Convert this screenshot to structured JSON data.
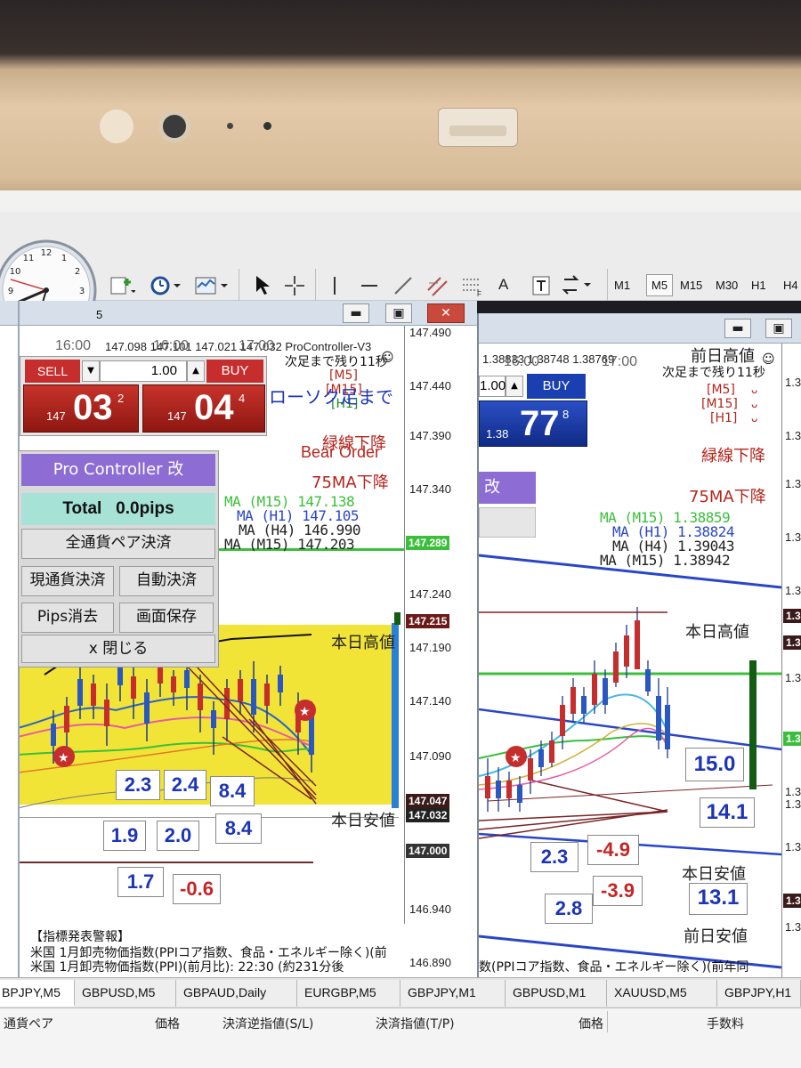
{
  "toolbar": {
    "timeframes": [
      "M1",
      "M5",
      "M15",
      "M30",
      "H1",
      "H4"
    ],
    "active_timeframe": "M5",
    "text_tool": "A"
  },
  "left_chart": {
    "window_title": "5",
    "info_line": "147.098 147.101 147.021 147.032 ProController-V3",
    "time_labels": [
      "16:00",
      "16:00",
      "17:00"
    ],
    "countdown": "次足まで残り11秒",
    "tf_markers": [
      "[M5]",
      "[M15]",
      "[H1]"
    ],
    "candle_label": "ローソク足まで",
    "trend_text": "緑線下降",
    "bear_order": "Bear Order",
    "ma75_text": "75MA下降",
    "ma_lines": [
      {
        "label": "MA (M15) 147.138",
        "color": "#3bbf3b"
      },
      {
        "label": "MA (H1) 147.105",
        "color": "#2a46c8"
      },
      {
        "label": "MA (H4) 146.990",
        "color": "#222222"
      },
      {
        "label": "MA (M15) 147.203",
        "color": "#222222"
      }
    ],
    "yaxis": [
      "147.490",
      "147.440",
      "147.390",
      "147.340",
      "147.289",
      "147.240",
      "147.215",
      "147.190",
      "147.140",
      "147.090",
      "147.047",
      "147.032",
      "147.000",
      "146.940",
      "146.890"
    ],
    "today_high": "本日高値",
    "today_low": "本日安値",
    "alert_header": "【指標発表警報】",
    "alert_line1": "米国 1月卸売物価指数(PPIコア指数、食品・エネルギー除く)(前",
    "alert_line2": "米国 1月卸売物価指数(PPI)(前月比): 22:30 (約231分後",
    "boxes": [
      "2.3",
      "2.4",
      "8.4",
      "1.9",
      "2.0",
      "8.4",
      "1.7",
      "-0.6"
    ]
  },
  "trade_panel": {
    "sell_label": "SELL",
    "buy_label": "BUY",
    "lot": "1.00",
    "sell_big": "147",
    "sell_price": "03",
    "sell_sup": "2",
    "buy_big": "147",
    "buy_price": "04",
    "buy_sup": "4"
  },
  "pro_panel": {
    "title": "Pro Controller 改",
    "total": "Total   0.0pips",
    "close_all": "全通貨ペア決済",
    "close_current": "現通貨決済",
    "auto_close": "自動決済",
    "pips_clear": "Pips消去",
    "save_screen": "画面保存",
    "close": "x 閉じる"
  },
  "right_chart": {
    "info_line": "1.38833 1.38748 1.38769",
    "time_labels": [
      "16:00",
      "17:00"
    ],
    "prev_high": "前日高値",
    "countdown": "次足まで残り11秒",
    "tf_markers": [
      "[M5]",
      "[M15]",
      "[H1]"
    ],
    "lot": "1.00",
    "buy_label": "BUY",
    "buy_big": "1.38",
    "buy_price": "77",
    "buy_sup": "8",
    "panel_stub": "改",
    "trend_text": "緑線下降",
    "ma75_text": "75MA下降",
    "ma_lines": [
      {
        "label": "MA (M15) 1.38859",
        "color": "#3bbf3b"
      },
      {
        "label": "MA (H1) 1.38824",
        "color": "#2a46c8"
      },
      {
        "label": "MA (H4) 1.39043",
        "color": "#222222"
      },
      {
        "label": "MA (M15) 1.38942",
        "color": "#222222"
      }
    ],
    "today_high": "本日高値",
    "today_low": "本日安値",
    "prev_low": "前日安値",
    "boxes": [
      "15.0",
      "14.1",
      "2.3",
      "-4.9",
      "2.8",
      "-3.9",
      "13.1"
    ],
    "alert_line1": "数(PPIコア指数、食品・エネルギー除く)(前年同",
    "axis_stub": "1.3"
  },
  "tabs": [
    "BPJPY,M5",
    "GBPUSD,M5",
    "GBPAUD,Daily",
    "EURGBP,M5",
    "GBPJPY,M1",
    "GBPUSD,M1",
    "XAUUSD,M5",
    "GBPJPY,H1"
  ],
  "columns": [
    "通貨ペア",
    "価格",
    "決済逆指値(S/L)",
    "決済指値(T/P)",
    "価格",
    "手数料"
  ],
  "colors": {
    "sell_red": "#b71c17",
    "buy_blue": "#1a3fb0",
    "panel_purple": "#8d6cd3",
    "zone_yellow": "#f1e437",
    "green_line": "#3bbf3b"
  }
}
